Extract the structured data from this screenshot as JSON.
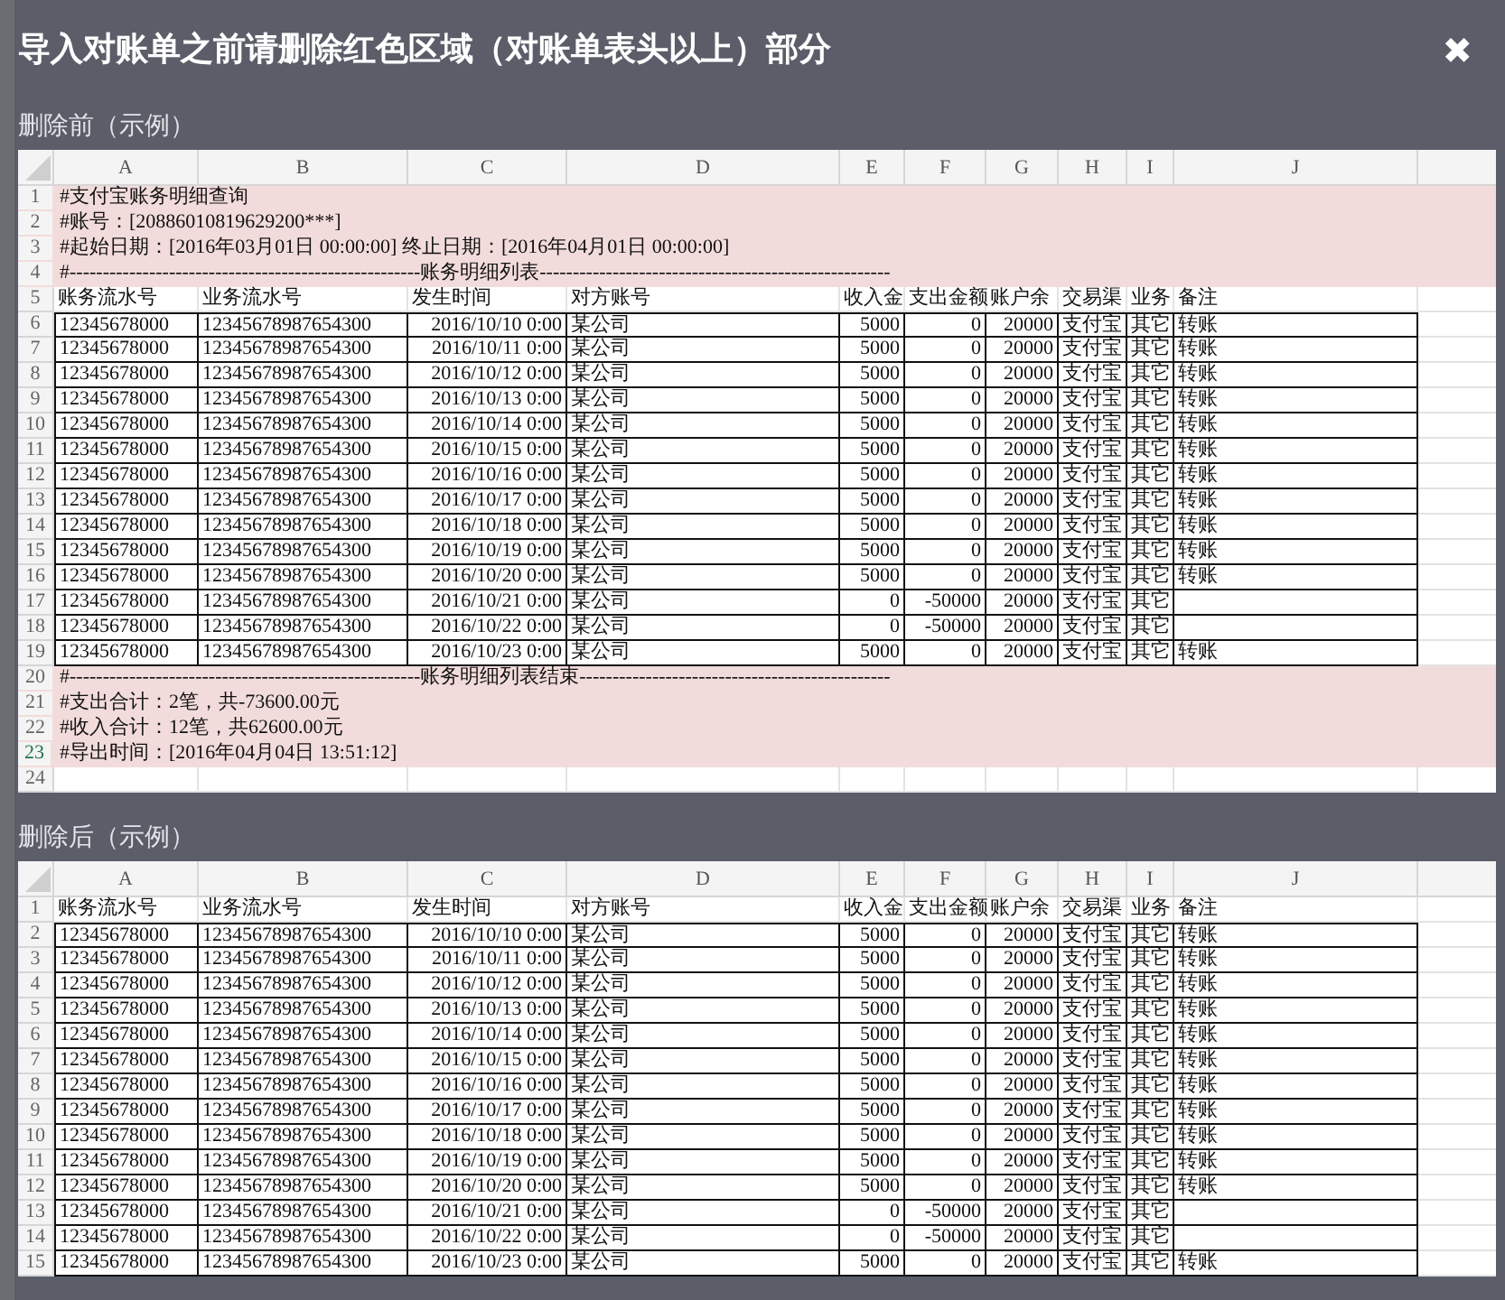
{
  "modal": {
    "title": "导入对账单之前请删除红色区域（对账单表头以上）部分",
    "close": "✖"
  },
  "sheets": [
    {
      "label": "删除前（示例）",
      "columns": [
        "A",
        "B",
        "C",
        "D",
        "E",
        "F",
        "G",
        "H",
        "I",
        "J"
      ],
      "rows": [
        {
          "number": "1",
          "kind": "note",
          "selected": false,
          "text": "#支付宝账务明细查询"
        },
        {
          "number": "2",
          "kind": "note",
          "selected": false,
          "text": "#账号：[20886010819629200***]"
        },
        {
          "number": "3",
          "kind": "note",
          "selected": false,
          "text": "#起始日期：[2016年03月01日 00:00:00]    终止日期：[2016年04月01日 00:00:00]"
        },
        {
          "number": "4",
          "kind": "note",
          "selected": false,
          "text": "#-----------------------------------------------------账务明细列表-----------------------------------------------------"
        },
        {
          "number": "5",
          "kind": "header",
          "selected": false,
          "cells": [
            "账务流水号",
            "业务流水号",
            "发生时间",
            "对方账号",
            "收入金",
            "支出金额",
            "账户余",
            "交易渠",
            "业务",
            "备注"
          ]
        },
        {
          "number": "6",
          "kind": "data",
          "selected": false,
          "cells": [
            "12345678000",
            "12345678987654300",
            "2016/10/10 0:00",
            "某公司",
            "5000",
            "0",
            "20000",
            "支付宝",
            "其它",
            "转账"
          ]
        },
        {
          "number": "7",
          "kind": "data",
          "selected": false,
          "cells": [
            "12345678000",
            "12345678987654300",
            "2016/10/11 0:00",
            "某公司",
            "5000",
            "0",
            "20000",
            "支付宝",
            "其它",
            "转账"
          ]
        },
        {
          "number": "8",
          "kind": "data",
          "selected": false,
          "cells": [
            "12345678000",
            "12345678987654300",
            "2016/10/12 0:00",
            "某公司",
            "5000",
            "0",
            "20000",
            "支付宝",
            "其它",
            "转账"
          ]
        },
        {
          "number": "9",
          "kind": "data",
          "selected": false,
          "cells": [
            "12345678000",
            "12345678987654300",
            "2016/10/13 0:00",
            "某公司",
            "5000",
            "0",
            "20000",
            "支付宝",
            "其它",
            "转账"
          ]
        },
        {
          "number": "10",
          "kind": "data",
          "selected": false,
          "cells": [
            "12345678000",
            "12345678987654300",
            "2016/10/14 0:00",
            "某公司",
            "5000",
            "0",
            "20000",
            "支付宝",
            "其它",
            "转账"
          ]
        },
        {
          "number": "11",
          "kind": "data",
          "selected": false,
          "cells": [
            "12345678000",
            "12345678987654300",
            "2016/10/15 0:00",
            "某公司",
            "5000",
            "0",
            "20000",
            "支付宝",
            "其它",
            "转账"
          ]
        },
        {
          "number": "12",
          "kind": "data",
          "selected": false,
          "cells": [
            "12345678000",
            "12345678987654300",
            "2016/10/16 0:00",
            "某公司",
            "5000",
            "0",
            "20000",
            "支付宝",
            "其它",
            "转账"
          ]
        },
        {
          "number": "13",
          "kind": "data",
          "selected": false,
          "cells": [
            "12345678000",
            "12345678987654300",
            "2016/10/17 0:00",
            "某公司",
            "5000",
            "0",
            "20000",
            "支付宝",
            "其它",
            "转账"
          ]
        },
        {
          "number": "14",
          "kind": "data",
          "selected": false,
          "cells": [
            "12345678000",
            "12345678987654300",
            "2016/10/18 0:00",
            "某公司",
            "5000",
            "0",
            "20000",
            "支付宝",
            "其它",
            "转账"
          ]
        },
        {
          "number": "15",
          "kind": "data",
          "selected": false,
          "cells": [
            "12345678000",
            "12345678987654300",
            "2016/10/19 0:00",
            "某公司",
            "5000",
            "0",
            "20000",
            "支付宝",
            "其它",
            "转账"
          ]
        },
        {
          "number": "16",
          "kind": "data",
          "selected": false,
          "cells": [
            "12345678000",
            "12345678987654300",
            "2016/10/20 0:00",
            "某公司",
            "5000",
            "0",
            "20000",
            "支付宝",
            "其它",
            "转账"
          ]
        },
        {
          "number": "17",
          "kind": "data",
          "selected": false,
          "cells": [
            "12345678000",
            "12345678987654300",
            "2016/10/21 0:00",
            "某公司",
            "0",
            "-50000",
            "20000",
            "支付宝",
            "其它"
          ]
        },
        {
          "number": "18",
          "kind": "data",
          "selected": false,
          "cells": [
            "12345678000",
            "12345678987654300",
            "2016/10/22 0:00",
            "某公司",
            "0",
            "-50000",
            "20000",
            "支付宝",
            "其它"
          ]
        },
        {
          "number": "19",
          "kind": "data",
          "selected": false,
          "cells": [
            "12345678000",
            "12345678987654300",
            "2016/10/23 0:00",
            "某公司",
            "5000",
            "0",
            "20000",
            "支付宝",
            "其它",
            "转账"
          ]
        },
        {
          "number": "20",
          "kind": "note",
          "selected": false,
          "text": "#-----------------------------------------------------账务明细列表结束-----------------------------------------------"
        },
        {
          "number": "21",
          "kind": "note",
          "selected": false,
          "text": "#支出合计：2笔，共-73600.00元"
        },
        {
          "number": "22",
          "kind": "note",
          "selected": false,
          "text": "#收入合计：12笔，共62600.00元"
        },
        {
          "number": "23",
          "kind": "note",
          "selected": true,
          "text": "#导出时间：[2016年04月04日 13:51:12]"
        },
        {
          "number": "24",
          "kind": "blank",
          "selected": false
        }
      ]
    },
    {
      "label": "删除后（示例）",
      "columns": [
        "A",
        "B",
        "C",
        "D",
        "E",
        "F",
        "G",
        "H",
        "I",
        "J"
      ],
      "rows": [
        {
          "number": "1",
          "kind": "header",
          "selected": false,
          "cells": [
            "账务流水号",
            "业务流水号",
            "发生时间",
            "对方账号",
            "收入金",
            "支出金额",
            "账户余",
            "交易渠",
            "业务",
            "备注"
          ]
        },
        {
          "number": "2",
          "kind": "data",
          "selected": false,
          "cells": [
            "12345678000",
            "12345678987654300",
            "2016/10/10 0:00",
            "某公司",
            "5000",
            "0",
            "20000",
            "支付宝",
            "其它",
            "转账"
          ]
        },
        {
          "number": "3",
          "kind": "data",
          "selected": false,
          "cells": [
            "12345678000",
            "12345678987654300",
            "2016/10/11 0:00",
            "某公司",
            "5000",
            "0",
            "20000",
            "支付宝",
            "其它",
            "转账"
          ]
        },
        {
          "number": "4",
          "kind": "data",
          "selected": false,
          "cells": [
            "12345678000",
            "12345678987654300",
            "2016/10/12 0:00",
            "某公司",
            "5000",
            "0",
            "20000",
            "支付宝",
            "其它",
            "转账"
          ]
        },
        {
          "number": "5",
          "kind": "data",
          "selected": false,
          "cells": [
            "12345678000",
            "12345678987654300",
            "2016/10/13 0:00",
            "某公司",
            "5000",
            "0",
            "20000",
            "支付宝",
            "其它",
            "转账"
          ]
        },
        {
          "number": "6",
          "kind": "data",
          "selected": false,
          "cells": [
            "12345678000",
            "12345678987654300",
            "2016/10/14 0:00",
            "某公司",
            "5000",
            "0",
            "20000",
            "支付宝",
            "其它",
            "转账"
          ]
        },
        {
          "number": "7",
          "kind": "data",
          "selected": false,
          "cells": [
            "12345678000",
            "12345678987654300",
            "2016/10/15 0:00",
            "某公司",
            "5000",
            "0",
            "20000",
            "支付宝",
            "其它",
            "转账"
          ]
        },
        {
          "number": "8",
          "kind": "data",
          "selected": false,
          "cells": [
            "12345678000",
            "12345678987654300",
            "2016/10/16 0:00",
            "某公司",
            "5000",
            "0",
            "20000",
            "支付宝",
            "其它",
            "转账"
          ]
        },
        {
          "number": "9",
          "kind": "data",
          "selected": false,
          "cells": [
            "12345678000",
            "12345678987654300",
            "2016/10/17 0:00",
            "某公司",
            "5000",
            "0",
            "20000",
            "支付宝",
            "其它",
            "转账"
          ]
        },
        {
          "number": "10",
          "kind": "data",
          "selected": false,
          "cells": [
            "12345678000",
            "12345678987654300",
            "2016/10/18 0:00",
            "某公司",
            "5000",
            "0",
            "20000",
            "支付宝",
            "其它",
            "转账"
          ]
        },
        {
          "number": "11",
          "kind": "data",
          "selected": false,
          "cells": [
            "12345678000",
            "12345678987654300",
            "2016/10/19 0:00",
            "某公司",
            "5000",
            "0",
            "20000",
            "支付宝",
            "其它",
            "转账"
          ]
        },
        {
          "number": "12",
          "kind": "data",
          "selected": false,
          "cells": [
            "12345678000",
            "12345678987654300",
            "2016/10/20 0:00",
            "某公司",
            "5000",
            "0",
            "20000",
            "支付宝",
            "其它",
            "转账"
          ]
        },
        {
          "number": "13",
          "kind": "data",
          "selected": false,
          "cells": [
            "12345678000",
            "12345678987654300",
            "2016/10/21 0:00",
            "某公司",
            "0",
            "-50000",
            "20000",
            "支付宝",
            "其它"
          ]
        },
        {
          "number": "14",
          "kind": "data",
          "selected": false,
          "cells": [
            "12345678000",
            "12345678987654300",
            "2016/10/22 0:00",
            "某公司",
            "0",
            "-50000",
            "20000",
            "支付宝",
            "其它"
          ]
        },
        {
          "number": "15",
          "kind": "data",
          "selected": false,
          "cells": [
            "12345678000",
            "12345678987654300",
            "2016/10/23 0:00",
            "某公司",
            "5000",
            "0",
            "20000",
            "支付宝",
            "其它",
            "转账"
          ]
        }
      ]
    }
  ]
}
